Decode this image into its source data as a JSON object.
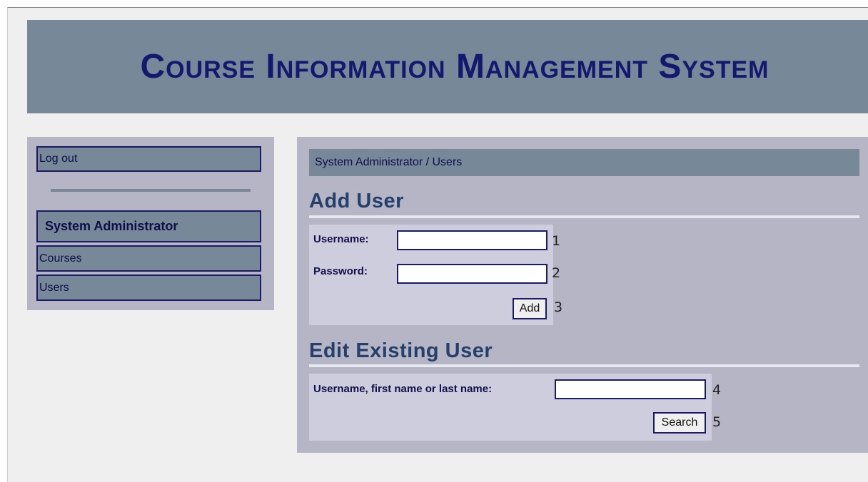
{
  "banner": {
    "title": "Course Information Management System"
  },
  "sidebar": {
    "logout_label": "Log out",
    "section_header": "System Administrator",
    "items": [
      {
        "label": "Courses"
      },
      {
        "label": "Users"
      }
    ]
  },
  "breadcrumb": "System Administrator / Users",
  "add_user": {
    "title": "Add User",
    "username_label": "Username:",
    "username_value": "",
    "password_label": "Password:",
    "password_value": "",
    "add_button": "Add",
    "markers": [
      "1",
      "2",
      "3"
    ]
  },
  "edit_user": {
    "title": "Edit Existing User",
    "search_label": "Username, first name or last name:",
    "search_value": "",
    "search_button": "Search",
    "markers": [
      "4",
      "5"
    ]
  },
  "colors": {
    "banner_bg": "#778899",
    "title_color": "#14186e",
    "panel_bg": "#b5b5c6",
    "form_bg": "#cdcddd",
    "border": "#1a1a66"
  }
}
